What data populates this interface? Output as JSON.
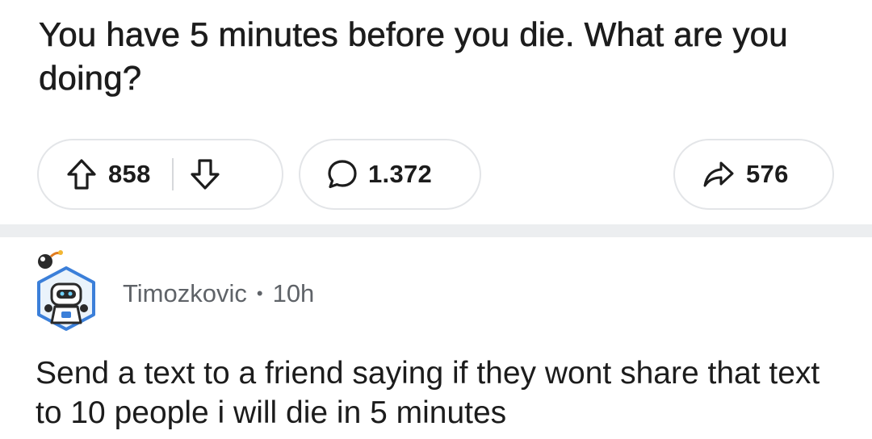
{
  "post": {
    "title": "You have 5 minutes before you die. What are you doing?"
  },
  "actions": {
    "upvote_icon": "arrow-up-outline-icon",
    "downvote_icon": "arrow-down-outline-icon",
    "vote_count": "858",
    "comment_icon": "speech-bubble-icon",
    "comment_count": "1.372",
    "share_icon": "share-arrow-icon",
    "share_count": "576"
  },
  "comment": {
    "author": "Timozkovic",
    "separator": "•",
    "age": "10h",
    "avatar_icon": "robot-avatar-icon",
    "body": "Send a text to a friend saying if they wont share that text to 10 people i will die in 5 minutes"
  },
  "colors": {
    "text": "#1c1c1c",
    "muted": "#5f6368",
    "pill_border": "#e3e5e8",
    "divider": "#eceef0",
    "avatar_blue": "#3b7fd9"
  }
}
